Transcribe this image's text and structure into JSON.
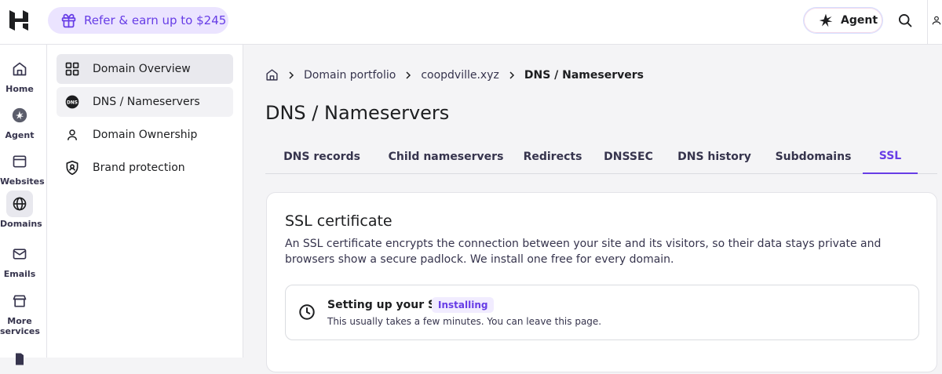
{
  "header": {
    "refer_label": "Refer & earn up to $245",
    "agent_label": "Agent",
    "icons": [
      "hostinger-logo-icon",
      "gift-icon",
      "agent-sparkle-icon",
      "search-icon",
      "user-icon"
    ]
  },
  "rail": {
    "items": [
      {
        "label": "Home",
        "icon": "home-icon"
      },
      {
        "label": "Agent",
        "icon": "agent-icon"
      },
      {
        "label": "Websites",
        "icon": "websites-icon"
      },
      {
        "label": "Domains",
        "icon": "globe-icon"
      },
      {
        "label": "Emails",
        "icon": "mail-icon"
      },
      {
        "label_1": "More",
        "label_2": "services",
        "icon": "store-icon"
      }
    ]
  },
  "subnav": {
    "items": [
      {
        "label": "Domain Overview",
        "icon": "grid-icon"
      },
      {
        "label": "DNS / Nameservers",
        "icon": "dns-icon"
      },
      {
        "label": "Domain Ownership",
        "icon": "person-icon"
      },
      {
        "label": "Brand protection",
        "icon": "shield-icon"
      }
    ]
  },
  "breadcrumb": {
    "items": [
      "Domain portfolio",
      "coopdville.xyz",
      "DNS / Nameservers"
    ]
  },
  "page": {
    "title": "DNS / Nameservers"
  },
  "tabs": [
    "DNS records",
    "Child nameservers",
    "Redirects",
    "DNSSEC",
    "DNS history",
    "Subdomains",
    "SSL"
  ],
  "active_tab": "SSL",
  "ssl_card": {
    "title": "SSL certificate",
    "description": "An SSL certificate encrypts the connection between your site and its visitors, so their data stays private and browsers show a secure padlock. We install one free for every domain.",
    "status_title": "Setting up your SSL",
    "status_badge": "Installing",
    "status_sub": "This usually takes a few minutes. You can leave this page."
  },
  "colors": {
    "accent": "#673de6",
    "refer_bg": "#ebe4ff",
    "text": "#1d1e20",
    "page_bg": "#f4f4f6"
  }
}
